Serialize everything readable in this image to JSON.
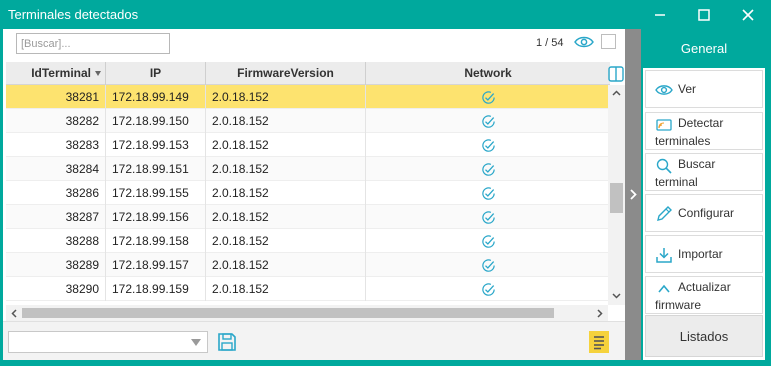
{
  "window": {
    "title": "Terminales detectados",
    "accent_color": "#00a99d",
    "selected_row_color": "#fde36f",
    "controls": [
      "minimize-icon",
      "maximize-icon",
      "close-icon"
    ]
  },
  "toolbar": {
    "search_placeholder": "[Buscar]...",
    "search_value": "",
    "page_counter": "1 / 54",
    "eye_icon": "eye-icon"
  },
  "grid": {
    "columns": [
      "IdTerminal",
      "IP",
      "FirmwareVersion",
      "Network"
    ],
    "sort_indicator_column": "IdTerminal",
    "selected_index": 0,
    "rows": [
      {
        "id": "38281",
        "ip": "172.18.99.149",
        "firmware": "2.0.18.152",
        "network": "check-circle-icon"
      },
      {
        "id": "38282",
        "ip": "172.18.99.150",
        "firmware": "2.0.18.152",
        "network": "check-circle-icon"
      },
      {
        "id": "38283",
        "ip": "172.18.99.153",
        "firmware": "2.0.18.152",
        "network": "check-circle-icon"
      },
      {
        "id": "38284",
        "ip": "172.18.99.151",
        "firmware": "2.0.18.152",
        "network": "check-circle-icon"
      },
      {
        "id": "38286",
        "ip": "172.18.99.155",
        "firmware": "2.0.18.152",
        "network": "check-circle-icon"
      },
      {
        "id": "38287",
        "ip": "172.18.99.156",
        "firmware": "2.0.18.152",
        "network": "check-circle-icon"
      },
      {
        "id": "38288",
        "ip": "172.18.99.158",
        "firmware": "2.0.18.152",
        "network": "check-circle-icon"
      },
      {
        "id": "38289",
        "ip": "172.18.99.157",
        "firmware": "2.0.18.152",
        "network": "check-circle-icon"
      },
      {
        "id": "38290",
        "ip": "172.18.99.159",
        "firmware": "2.0.18.152",
        "network": "check-circle-icon"
      }
    ]
  },
  "bottom_bar": {
    "filter_value": "",
    "save_icon": "save-icon",
    "export_icon": "list-export-icon"
  },
  "panel": {
    "header": "General",
    "actions": [
      {
        "key": "ver",
        "line1": "Ver",
        "line2": "",
        "icon": "eye-icon"
      },
      {
        "key": "detectar",
        "line1": "Detectar",
        "line2": "terminales",
        "icon": "terminal-detect-icon"
      },
      {
        "key": "buscar",
        "line1": "Buscar",
        "line2": "terminal",
        "icon": "search-icon"
      },
      {
        "key": "configurar",
        "line1": "Configurar",
        "line2": "",
        "icon": "pencil-icon"
      },
      {
        "key": "importar",
        "line1": "Importar",
        "line2": "",
        "icon": "import-icon"
      },
      {
        "key": "actualizar",
        "line1": "Actualizar",
        "line2": "firmware",
        "icon": "chevron-up-icon"
      }
    ],
    "footer": "Listados"
  }
}
